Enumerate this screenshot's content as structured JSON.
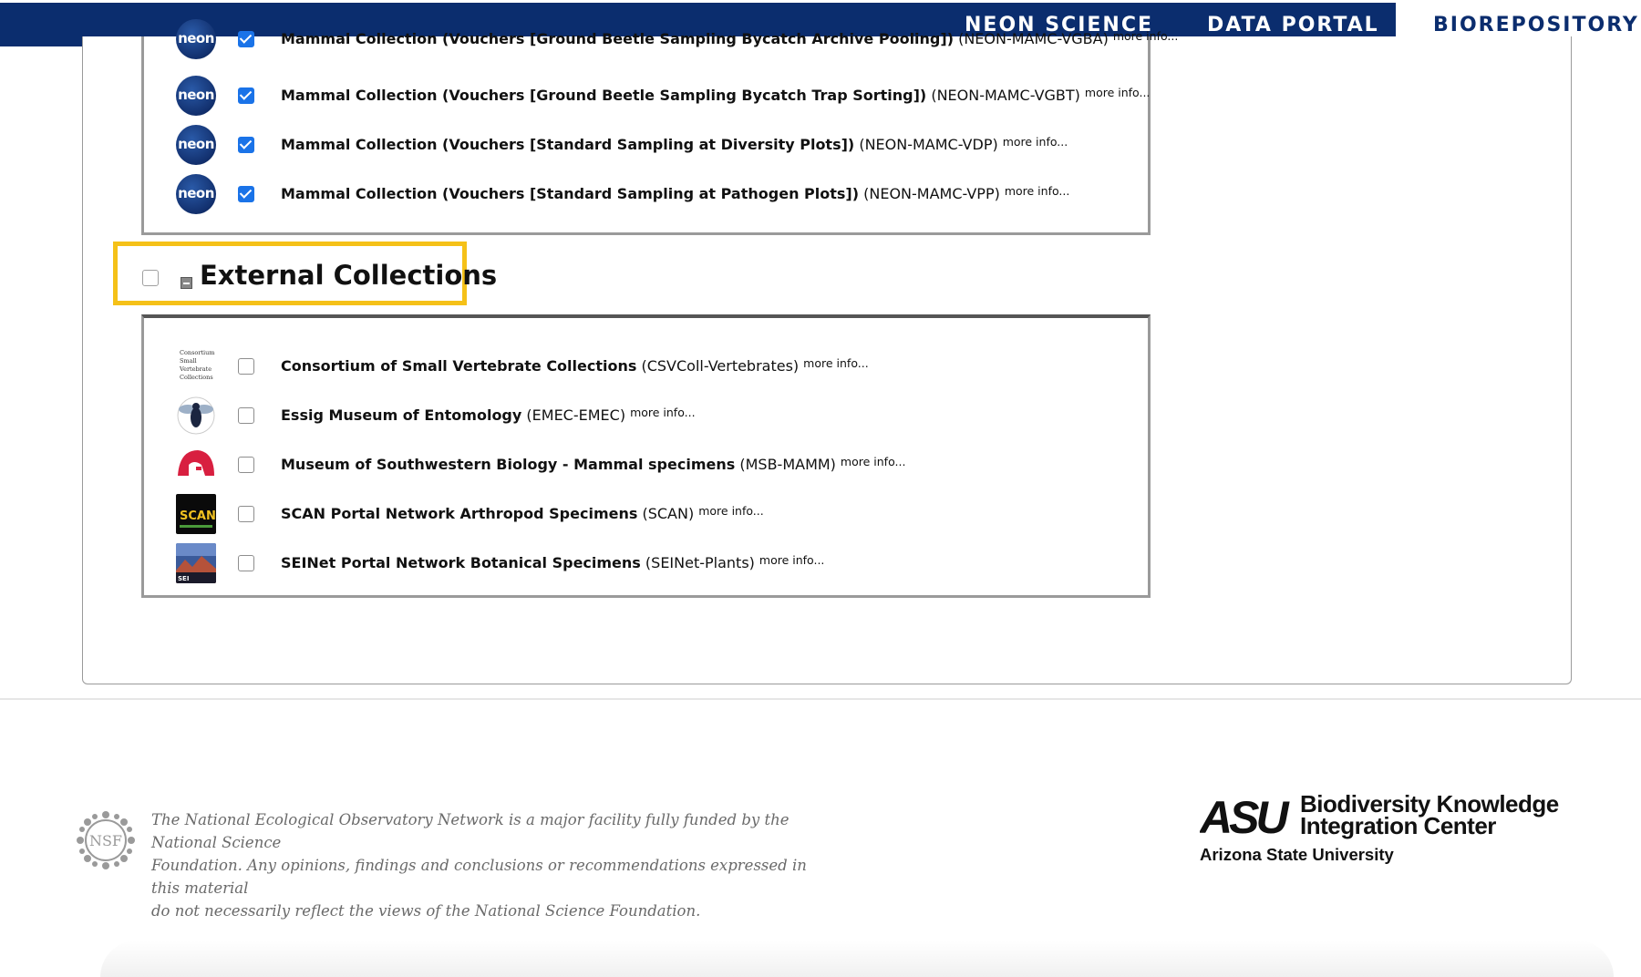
{
  "nav": {
    "tabs": [
      {
        "label": "NEON SCIENCE"
      },
      {
        "label": "DATA PORTAL"
      },
      {
        "label": "BIOREPOSITORY"
      }
    ],
    "active_tab": "BIOREPOSITORY",
    "color": "#0b2d6e"
  },
  "neon_collections": {
    "logo_text": "neon",
    "more_label": "more info...",
    "items": [
      {
        "name": "Mammal Collection (Vouchers [Ground Beetle Sampling Bycatch Archive Pooling])",
        "code": "(NEON-MAMC-VGBA)",
        "checked": true
      },
      {
        "name": "Mammal Collection (Vouchers [Ground Beetle Sampling Bycatch Trap Sorting])",
        "code": "(NEON-MAMC-VGBT)",
        "checked": true
      },
      {
        "name": "Mammal Collection (Vouchers [Standard Sampling at Diversity Plots])",
        "code": "(NEON-MAMC-VDP)",
        "checked": true
      },
      {
        "name": "Mammal Collection (Vouchers [Standard Sampling at Pathogen Plots])",
        "code": "(NEON-MAMC-VPP)",
        "checked": true
      }
    ]
  },
  "external": {
    "title": "External Collections",
    "checked": false,
    "highlight_color": "#f5c118",
    "more_label": "more info...",
    "items": [
      {
        "name": "Consortium of Small Vertebrate Collections",
        "code": "(CSVColl-Vertebrates)",
        "logo_text": "Consortium of Small Vertebrate Collections",
        "checked": false
      },
      {
        "name": "Essig Museum of Entomology",
        "code": "(EMEC-EMEC)",
        "checked": false
      },
      {
        "name": "Museum of Southwestern Biology - Mammal specimens",
        "code": "(MSB-MAMM)",
        "checked": false
      },
      {
        "name": "SCAN Portal Network Arthropod Specimens",
        "code": "(SCAN)",
        "logo_text": "SCAN",
        "checked": false
      },
      {
        "name": "SEINet Portal Network Botanical Specimens",
        "code": "(SEINet-Plants)",
        "logo_text": "SEI",
        "checked": false
      }
    ]
  },
  "footer": {
    "nsf_seal_text": "NSF",
    "disclaimer_lines": [
      "The National Ecological Observatory Network is a major facility fully funded by the National Science",
      "Foundation. Any opinions, findings and conclusions or recommendations expressed in this material",
      "do not necessarily reflect the views of the National Science Foundation."
    ],
    "asu_logo_text": "ASU",
    "center_name_lines": [
      "Biodiversity Knowledge",
      "Integration Center"
    ],
    "university": "Arizona State University"
  }
}
